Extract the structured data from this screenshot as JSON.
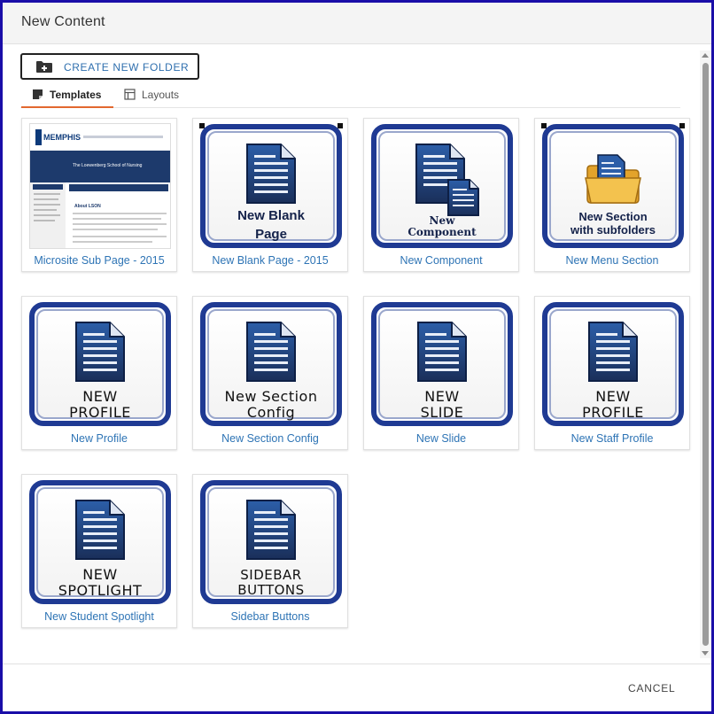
{
  "dialog": {
    "title": "New Content",
    "create_folder_label": "CREATE NEW FOLDER",
    "cancel_label": "CANCEL"
  },
  "tabs": [
    {
      "label": "Templates",
      "icon": "template-icon",
      "active": true
    },
    {
      "label": "Layouts",
      "icon": "layout-icon",
      "active": false
    }
  ],
  "cards": [
    {
      "label": "Microsite Sub Page - 2015",
      "thumb_lines": [],
      "thumb_style": "screenshot"
    },
    {
      "label": "New Blank Page - 2015",
      "thumb_lines": [
        "New Blank",
        "Page"
      ],
      "thumb_style": "bold"
    },
    {
      "label": "New Component",
      "thumb_lines": [
        "New",
        "Component"
      ],
      "thumb_style": "serif"
    },
    {
      "label": "New Menu Section",
      "thumb_lines": [
        "New Section",
        "with subfolders"
      ],
      "thumb_style": "folder"
    },
    {
      "label": "New Profile",
      "thumb_lines": [
        "NEW",
        "PROFILE"
      ],
      "thumb_style": "plain"
    },
    {
      "label": "New Section Config",
      "thumb_lines": [
        "New Section",
        "Config"
      ],
      "thumb_style": "plain"
    },
    {
      "label": "New Slide",
      "thumb_lines": [
        "NEW",
        "SLIDE"
      ],
      "thumb_style": "plain"
    },
    {
      "label": "New Staff Profile",
      "thumb_lines": [
        "NEW",
        "PROFILE"
      ],
      "thumb_style": "plain"
    },
    {
      "label": "New Student Spotlight",
      "thumb_lines": [
        "NEW",
        "SPOTLIGHT"
      ],
      "thumb_style": "plain"
    },
    {
      "label": "Sidebar Buttons",
      "thumb_lines": [
        "SIDEBAR",
        "BUTTONS"
      ],
      "thumb_style": "plain"
    }
  ],
  "microsite_preview": {
    "heading": "The Loewenberg School of Nursing",
    "subheading": "About LSON",
    "logo_text": "MEMPHIS"
  },
  "colors": {
    "link": "#2e74b5",
    "frame": "#1f3a93",
    "tab_accent": "#e2682f",
    "dialog_border": "#1a0ea8"
  }
}
